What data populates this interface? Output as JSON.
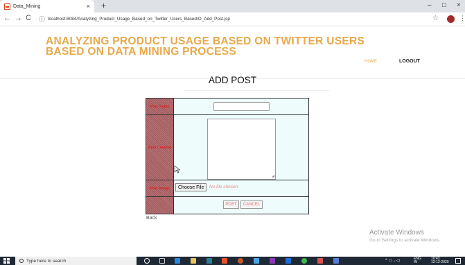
{
  "browser": {
    "tab_title": "Data_Mining",
    "tab_close": "×",
    "new_tab": "+",
    "url": "localhost:8084/Analyzing_Product_Usage_Based_on_Twitter_Users_Based/O_Add_Post.jsp",
    "controls": {
      "minimize": "–",
      "maximize": "□",
      "close": "×"
    },
    "nav": {
      "back": "←",
      "forward": "→",
      "reload": "C"
    }
  },
  "header": {
    "title": "ANALYZING PRODUCT USAGE BASED ON TWITTER USERS BASED ON DATA MINING PROCESS",
    "nav": {
      "home": "HOME",
      "logout": "LOGOUT"
    }
  },
  "page": {
    "heading": "ADD POST",
    "back": "Back"
  },
  "form": {
    "post_name_label": "Post Name",
    "post_content_label": "Post Content",
    "post_image_label": "Post Image",
    "choose_file": "Choose File",
    "no_file": "No file chosen",
    "post_button": "POST",
    "cancel_button": "CANCEL"
  },
  "watermark": {
    "title": "Activate Windows",
    "subtitle": "Go to Settings to activate Windows."
  },
  "taskbar": {
    "search_placeholder": "Type here to search",
    "lang": "ENG",
    "lang_sub": "IN",
    "time": "10:43",
    "date": "12-12-2020"
  },
  "colors": {
    "title": "#e8a94a",
    "label_bg": "#a0565a",
    "label_text": "#e02020",
    "cell_bg": "#eefcfc"
  }
}
